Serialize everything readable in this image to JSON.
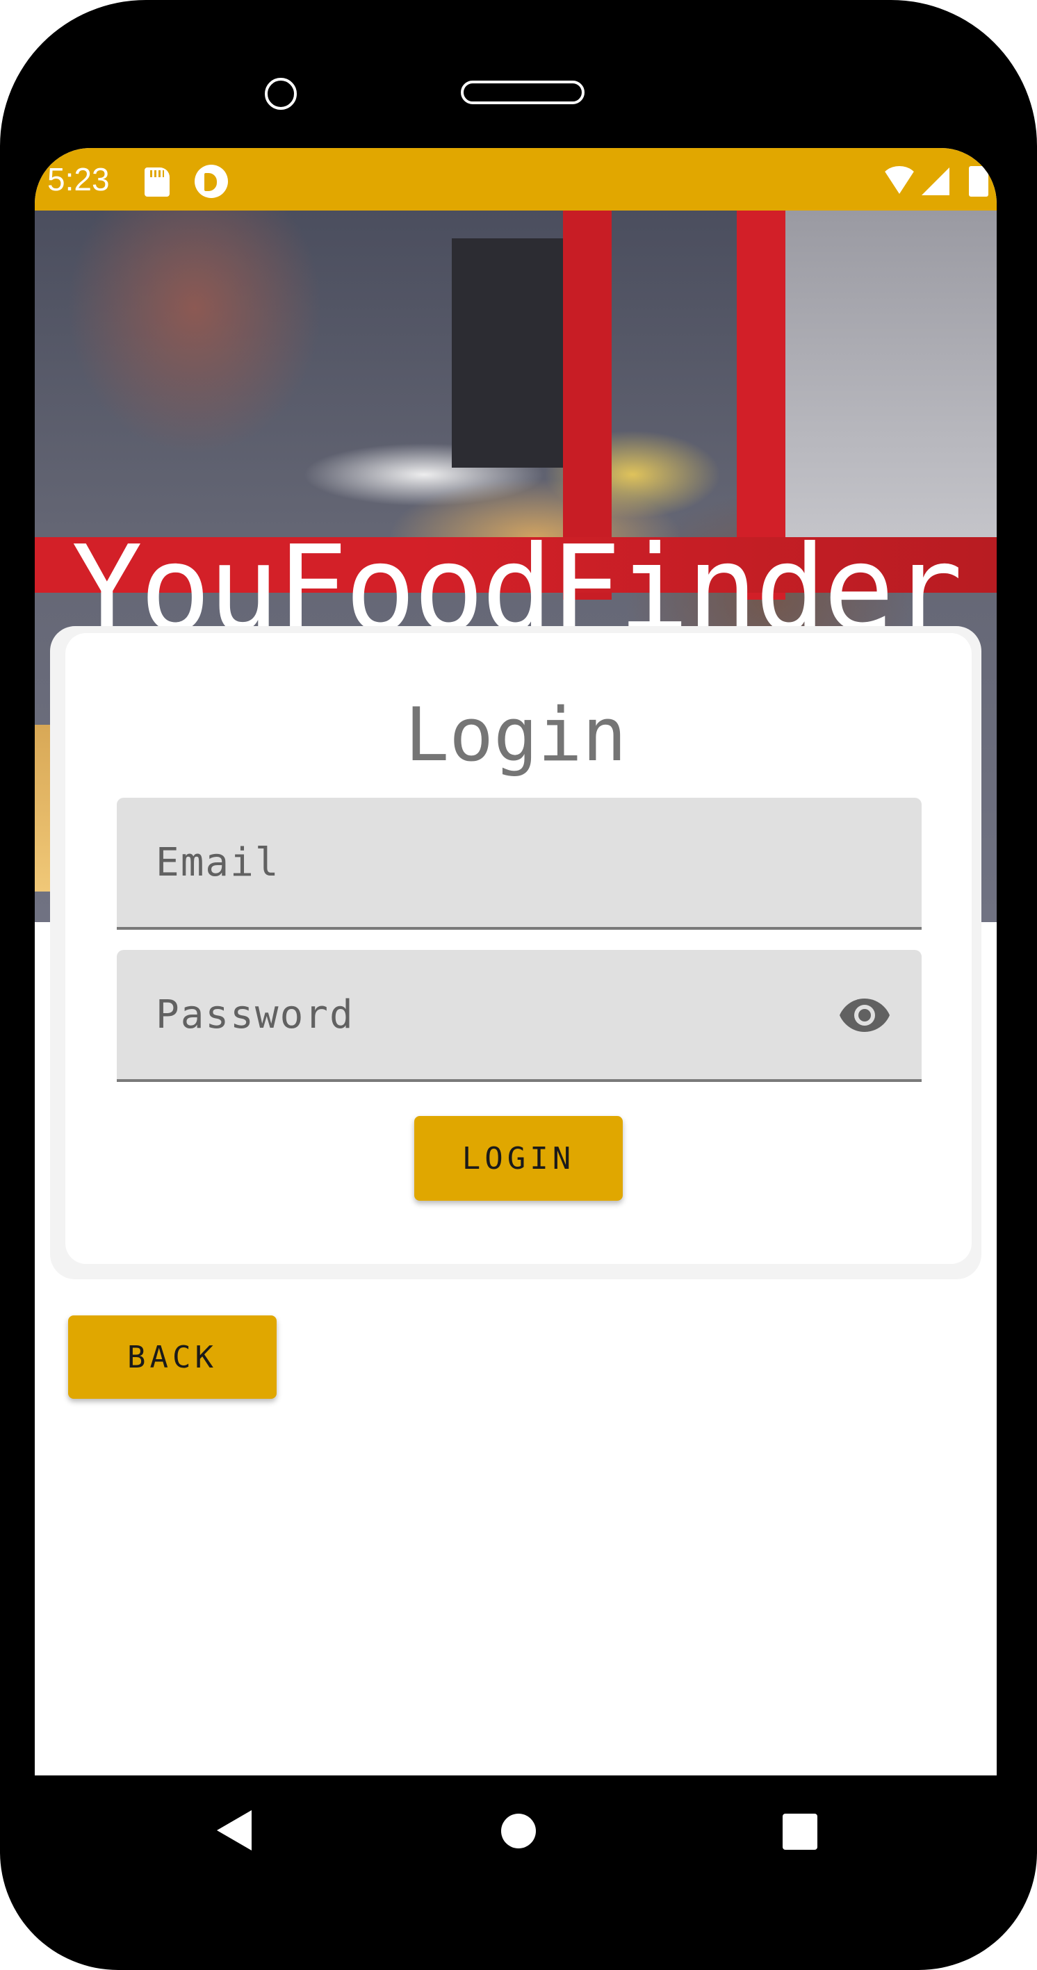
{
  "status_bar": {
    "time": "5:23",
    "icons": [
      "sd-card-icon",
      "app-notification-icon",
      "wifi-icon",
      "cell-signal-icon",
      "battery-icon"
    ],
    "background_color": "#e1a700"
  },
  "app": {
    "title": "YouFoodFinder"
  },
  "login_form": {
    "title": "Login",
    "email": {
      "placeholder": "Email",
      "value": ""
    },
    "password": {
      "placeholder": "Password",
      "value": "",
      "visibility_icon": "eye-icon"
    },
    "login_button_label": "LOGIN"
  },
  "back_button_label": "BACK",
  "nav_bar": {
    "icons": [
      "back-triangle-icon",
      "home-circle-icon",
      "recents-square-icon"
    ]
  },
  "colors": {
    "accent": "#e0a700",
    "field_background": "#e0e0e0",
    "hint_text": "#616161",
    "title_gray": "#757575"
  }
}
